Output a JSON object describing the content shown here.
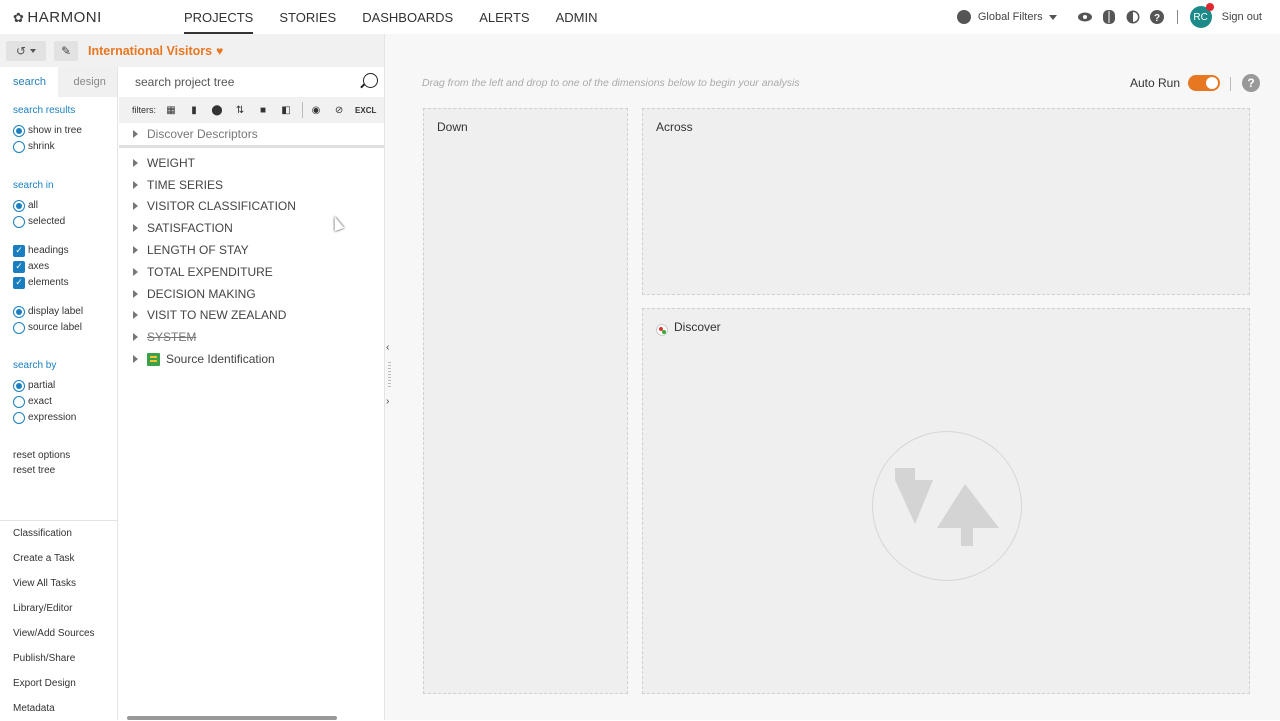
{
  "app": {
    "logo": "HARMONI"
  },
  "nav": [
    {
      "label": "PROJECTS",
      "active": true
    },
    {
      "label": "STORIES"
    },
    {
      "label": "DASHBOARDS"
    },
    {
      "label": "ALERTS"
    },
    {
      "label": "ADMIN"
    }
  ],
  "topright": {
    "global_filters": "Global Filters",
    "user_initials": "RC",
    "sign_out": "Sign out"
  },
  "project": {
    "title": "International Visitors"
  },
  "rail": {
    "tabs": [
      "search",
      "design"
    ],
    "search_results": {
      "title": "search results",
      "options": [
        "show in tree",
        "shrink"
      ],
      "selected": "show in tree"
    },
    "search_in": {
      "title": "search in",
      "options": [
        "all",
        "selected"
      ],
      "selected": "all",
      "checks": [
        "headings",
        "axes",
        "elements"
      ],
      "label_options": [
        "display label",
        "source label"
      ],
      "label_selected": "display label"
    },
    "search_by": {
      "title": "search by",
      "options": [
        "partial",
        "exact",
        "expression"
      ],
      "selected": "partial"
    },
    "links": [
      "reset options",
      "reset tree"
    ],
    "menu": [
      "Classification",
      "Create a Task",
      "View All Tasks",
      "Library/Editor",
      "View/Add Sources",
      "Publish/Share",
      "Export Design",
      "Metadata"
    ]
  },
  "tree": {
    "search_placeholder": "search project tree",
    "filters_label": "filters:",
    "excl_label": "EXCL",
    "descriptor": "Discover Descriptors",
    "items": [
      {
        "label": "WEIGHT"
      },
      {
        "label": "TIME SERIES"
      },
      {
        "label": "VISITOR CLASSIFICATION"
      },
      {
        "label": "SATISFACTION"
      },
      {
        "label": "LENGTH OF STAY"
      },
      {
        "label": "TOTAL EXPENDITURE"
      },
      {
        "label": "DECISION MAKING"
      },
      {
        "label": "VISIT TO NEW ZEALAND"
      },
      {
        "label": "SYSTEM",
        "strike": true
      },
      {
        "label": "Source Identification",
        "source": true
      }
    ]
  },
  "main": {
    "hint": "Drag from the left and drop to one of the dimensions below to begin your analysis",
    "auto_run": "Auto Run",
    "help": "?",
    "zones": {
      "down": "Down",
      "across": "Across",
      "discover": "Discover"
    }
  },
  "colors": {
    "accent": "#e87722",
    "link": "#1a7fc1",
    "avatar": "#1d8a8a"
  }
}
